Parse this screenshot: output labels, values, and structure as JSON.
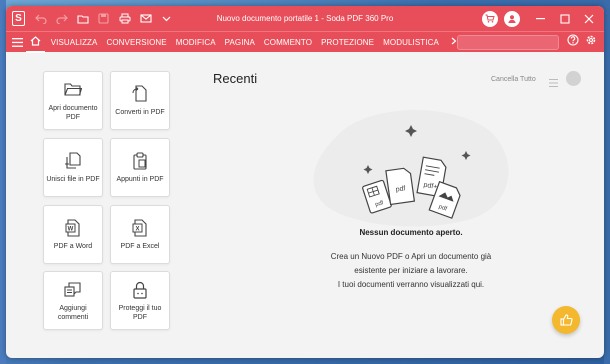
{
  "app": {
    "logo": "S",
    "document_title": "Nuovo documento portatile 1",
    "separator": "-",
    "product_name": "Soda PDF 360 Pro"
  },
  "quick_access": [
    "undo-icon",
    "redo-icon",
    "open-folder-icon",
    "save-icon",
    "print-icon",
    "email-icon",
    "dropdown-icon"
  ],
  "menu": {
    "items": [
      "VISUALIZZA",
      "CONVERSIONE",
      "MODIFICA",
      "PAGINA",
      "COMMENTO",
      "PROTEZIONE",
      "MODULISTICA"
    ],
    "search_placeholder": ""
  },
  "cards": [
    {
      "label": "Apri documento PDF",
      "icon": "folder-icon"
    },
    {
      "label": "Converti in PDF",
      "icon": "convert-icon"
    },
    {
      "label": "Unisci file in PDF",
      "icon": "merge-icon"
    },
    {
      "label": "Appunti in PDF",
      "icon": "clipboard-icon"
    },
    {
      "label": "PDF a Word",
      "icon": "word-icon"
    },
    {
      "label": "PDF a Excel",
      "icon": "excel-icon"
    },
    {
      "label": "Aggiungi commenti",
      "icon": "comment-icon"
    },
    {
      "label": "Proteggi il tuo PDF",
      "icon": "lock-icon"
    }
  ],
  "recent": {
    "title": "Recenti",
    "clear_label": "Cancella Tutto",
    "empty_title": "Nessun documento aperto.",
    "empty_line1": "Crea un Nuovo PDF o Apri un documento già",
    "empty_line2": "esistente per iniziare a lavorare.",
    "empty_line3": "I tuoi documenti verranno visualizzati qui."
  },
  "illustration_labels": {
    "pdf1": "pdf",
    "pdf2": "pdf",
    "pdf3": "pdf+",
    "pdf4": "pdf",
    "pdf5": "pdf"
  },
  "colors": {
    "brand": "#e84e5a",
    "fab": "#f4b82f"
  }
}
